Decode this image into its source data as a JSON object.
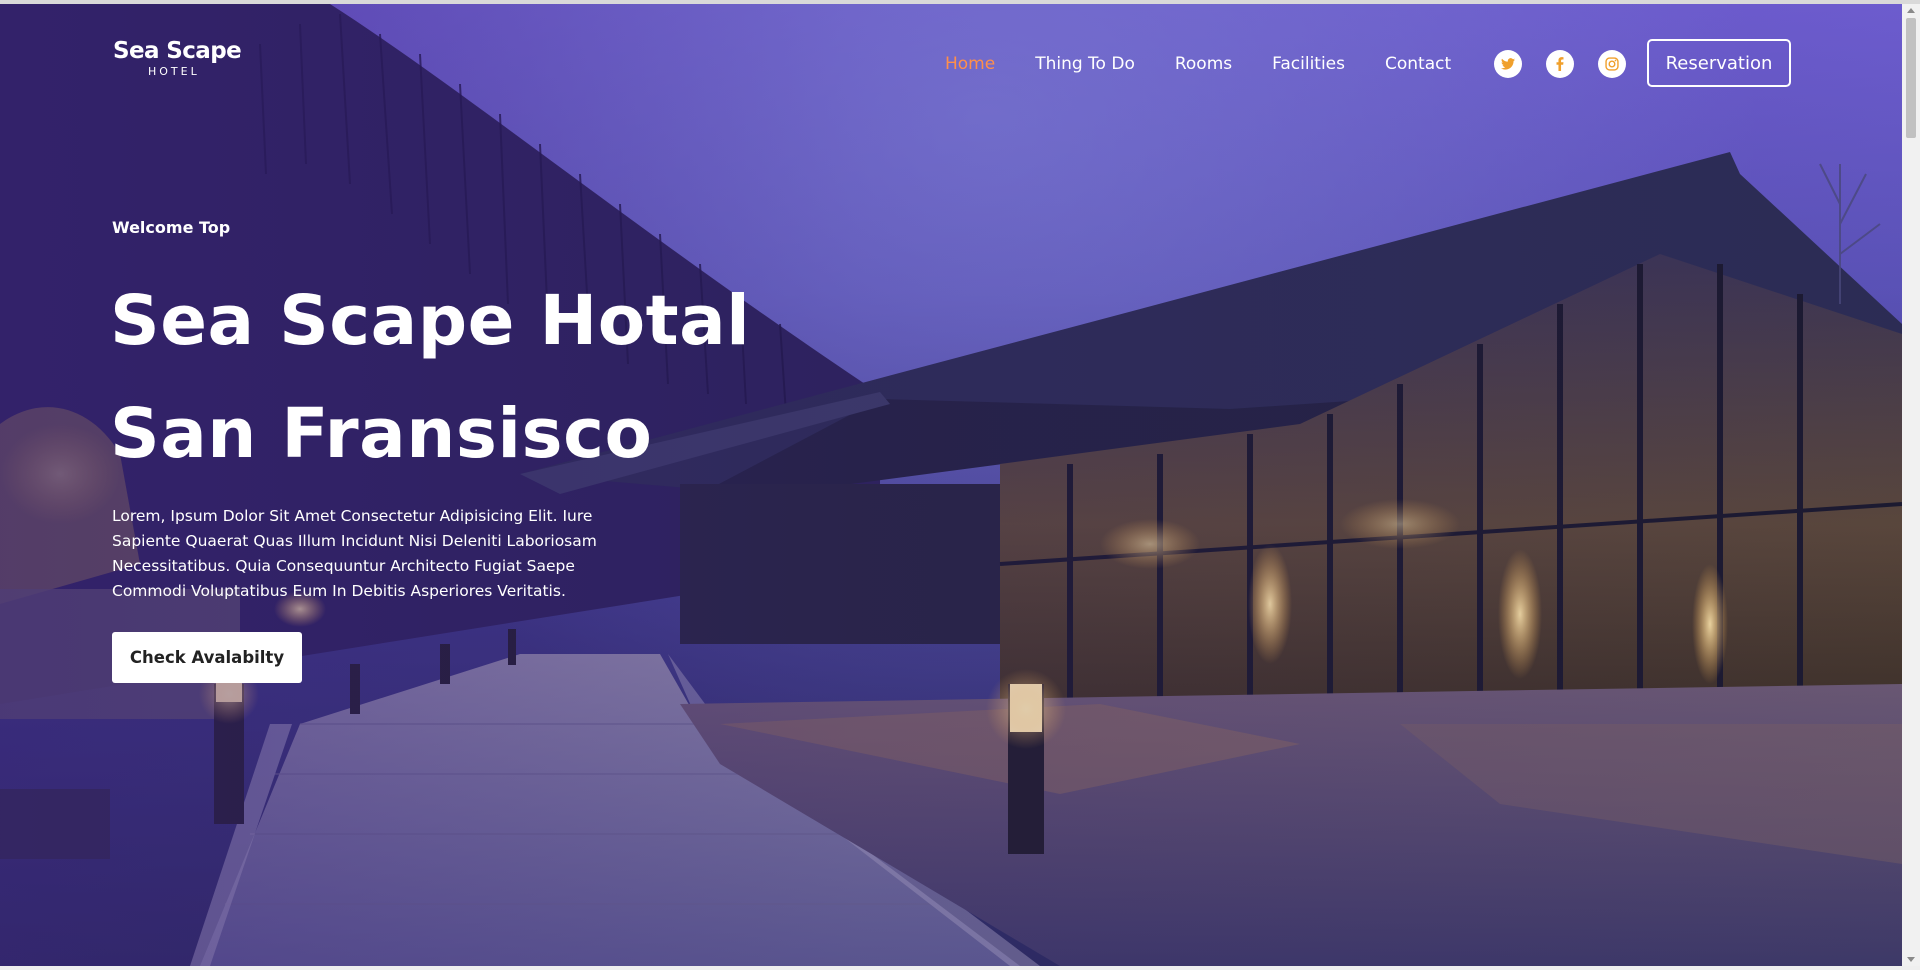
{
  "logo": {
    "main": "Sea Scape",
    "sub": "HOTEL"
  },
  "nav": {
    "items": [
      {
        "label": "Home",
        "active": true
      },
      {
        "label": "Thing To Do",
        "active": false
      },
      {
        "label": "Rooms",
        "active": false
      },
      {
        "label": "Facilities",
        "active": false
      },
      {
        "label": "Contact",
        "active": false
      }
    ],
    "active_color": "#ff8f4a"
  },
  "socials": [
    {
      "icon": "twitter-icon",
      "color": "#f0a02c"
    },
    {
      "icon": "facebook-icon",
      "color": "#f0a02c"
    },
    {
      "icon": "instagram-icon",
      "color": "#f0a02c"
    }
  ],
  "reservation_label": "Reservation",
  "hero": {
    "eyebrow": "Welcome Top",
    "title_line1": "Sea Scape Hotal",
    "title_line2": "San Fransisco",
    "description": "Lorem, Ipsum Dolor Sit Amet Consectetur Adipisicing Elit. Iure Sapiente Quaerat Quas Illum Incidunt Nisi Deleniti Laboriosam Necessitatibus. Quia Consequuntur Architecto Fugiat Saepe Commodi Voluptatibus Eum In Debitis Asperiores Veritatis.",
    "cta_label": "Check Avalabilty"
  }
}
